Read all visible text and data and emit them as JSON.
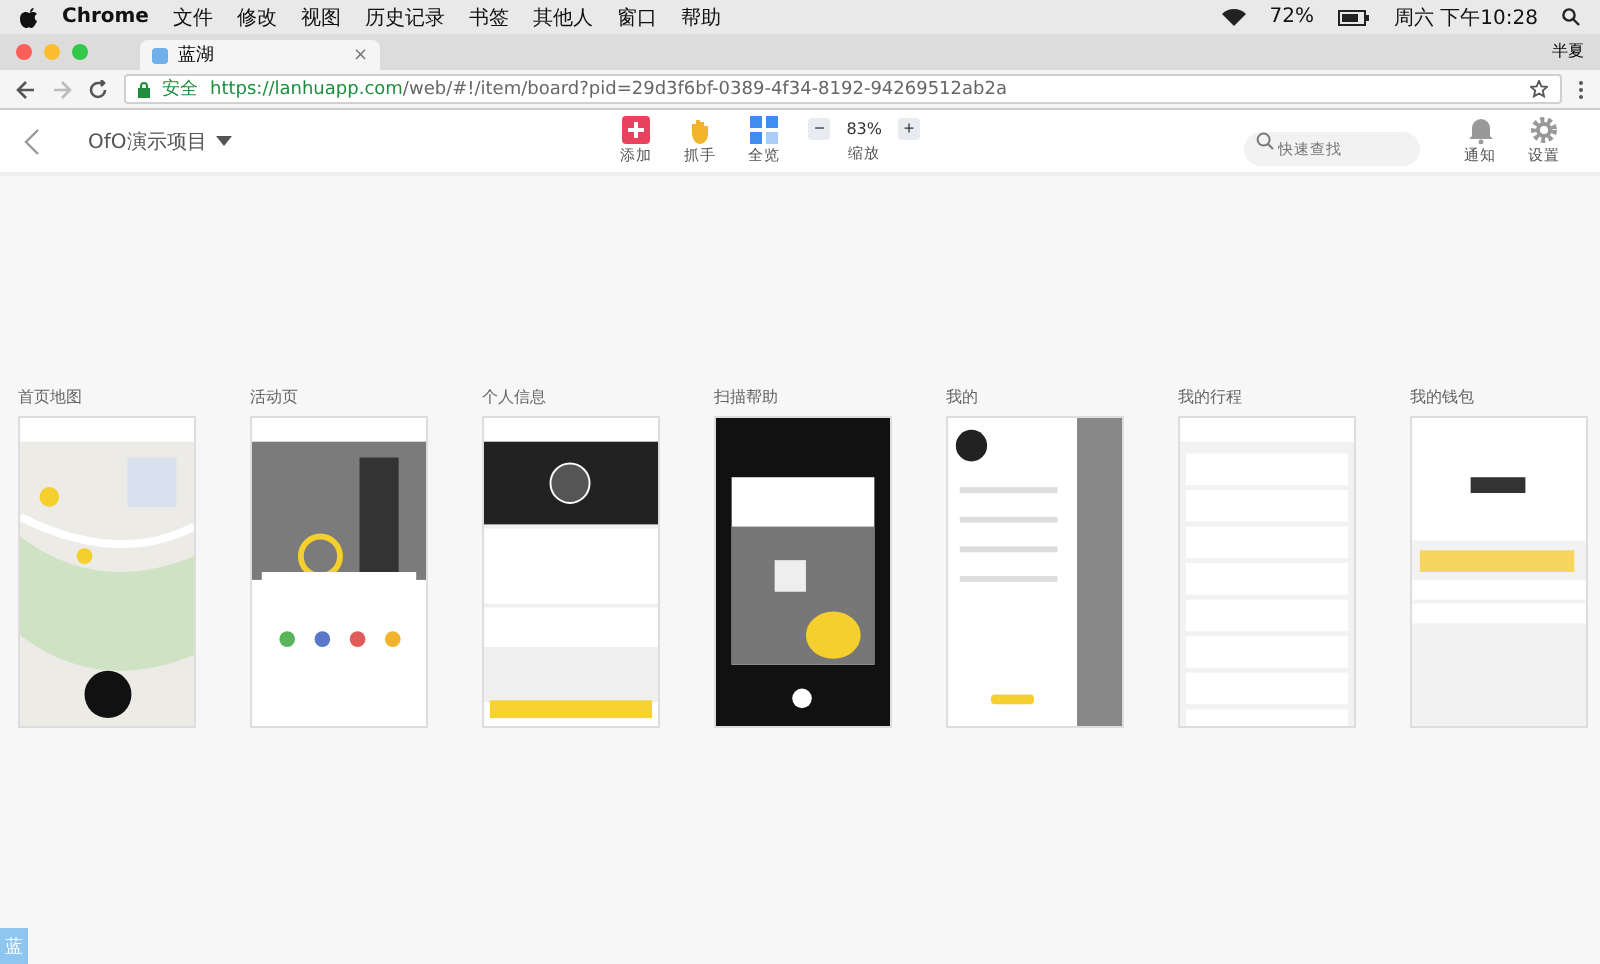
{
  "menu_bar": {
    "app": "Chrome",
    "items": [
      "文件",
      "修改",
      "视图",
      "历史记录",
      "书签",
      "其他人",
      "窗口",
      "帮助"
    ],
    "battery": "72%",
    "clock": "周六 下午10:28"
  },
  "browser": {
    "tab_title": "蓝湖",
    "tab_close": "×",
    "profile": "半夏",
    "secure_label": "安全",
    "url_host": "https://lanhuapp.com",
    "url_path": "/web/#!/item/board?pid=29d3f6bf-0389-4f34-8192-94269512ab2a"
  },
  "toolbar": {
    "project": "OfO演示项目",
    "tools": [
      {
        "kind": "add",
        "label": "添加"
      },
      {
        "kind": "hand",
        "label": "抓手"
      },
      {
        "kind": "overview",
        "label": "全览"
      }
    ],
    "zoom": {
      "minus": "−",
      "value": "83%",
      "plus": "+",
      "label": "缩放"
    },
    "search": {
      "placeholder": "快速查找"
    },
    "actions": [
      {
        "kind": "bell",
        "label": "通知"
      },
      {
        "kind": "gear",
        "label": "设置"
      }
    ]
  },
  "boards": [
    {
      "title": "首页地图",
      "kind": "picture"
    },
    {
      "title": "活动页",
      "kind": "picture"
    },
    {
      "title": "个人信息",
      "kind": "picture"
    },
    {
      "title": "扫描帮助",
      "kind": "picture"
    },
    {
      "title": "我的",
      "kind": "picture"
    },
    {
      "title": "我的行程",
      "kind": "picture"
    },
    {
      "title": "我的钱包",
      "kind": "picture"
    }
  ],
  "corner_badge": "蓝"
}
